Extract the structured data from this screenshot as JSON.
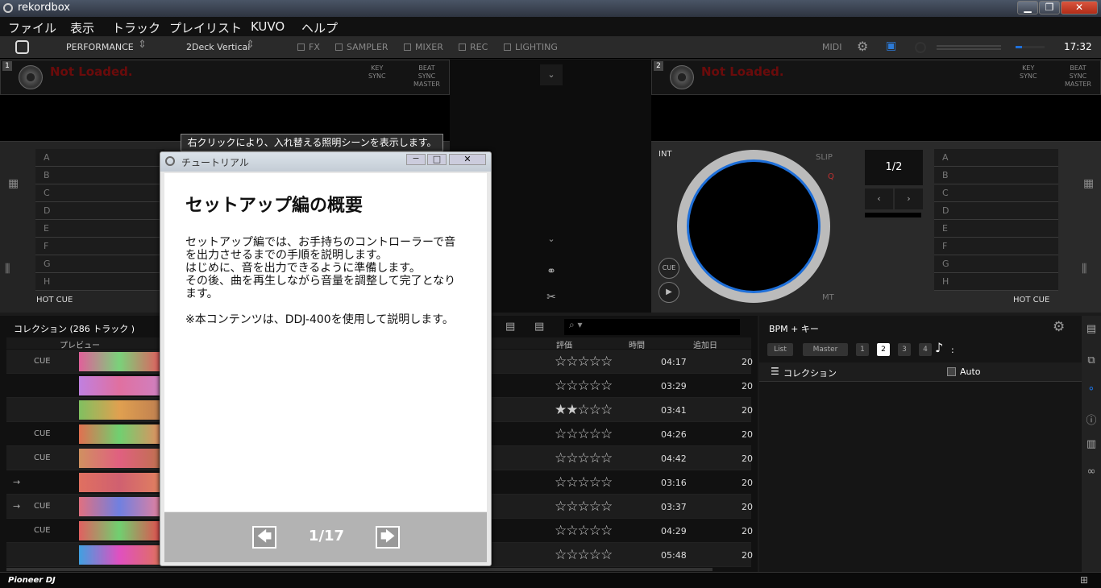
{
  "window": {
    "title": "rekordbox",
    "min": "▁",
    "max": "❐",
    "close": "✕"
  },
  "menu": [
    "ファイル",
    "表示",
    "トラック",
    "プレイリスト",
    "KUVO",
    "ヘルプ"
  ],
  "toolbar": {
    "mode": "PERFORMANCE",
    "layout": "2Deck Vertical",
    "toggles": [
      "FX",
      "SAMPLER",
      "MIXER",
      "REC",
      "LIGHTING"
    ],
    "midi": "MIDI",
    "clock": "17:32"
  },
  "deck1": {
    "number": "1",
    "status": "Not Loaded.",
    "key_sync": "KEY\nSYNC",
    "beat_sync": "BEAT\nSYNC\nMASTER",
    "hot_cue": "HOT CUE",
    "pads": [
      "A",
      "B",
      "C",
      "D",
      "E",
      "F",
      "G",
      "H"
    ]
  },
  "deck2": {
    "number": "2",
    "status": "Not Loaded.",
    "key_sync": "KEY\nSYNC",
    "beat_sync": "BEAT\nSYNC\nMASTER",
    "hot_cue": "HOT CUE",
    "pads": [
      "A",
      "B",
      "C",
      "D",
      "E",
      "F",
      "G",
      "H"
    ],
    "int": "INT",
    "slip": "SLIP",
    "q": "Q",
    "mt": "MT",
    "cue": "CUE",
    "loop": "1/2"
  },
  "tooltip": "右クリックにより、入れ替える照明シーンを表示します。",
  "dialog": {
    "title": "チュートリアル",
    "heading": "セットアップ編の概要",
    "body1": "セットアップ編では、お手持ちのコントローラーで音を出力させるまでの手順を説明します。",
    "body2": "はじめに、音を出力できるように準備します。",
    "body3": "その後、曲を再生しながら音量を調整して完了となります。",
    "note": "※本コンテンツは、DDJ-400を使用して説明します。",
    "page": "1/17",
    "prev": "🡄",
    "next": "🡆"
  },
  "browser": {
    "collection": "コレクション (286 トラック )",
    "col_preview": "プレビュー",
    "col_rating": "評価",
    "col_time": "時間",
    "col_added": "追加日",
    "rows": [
      {
        "cue": "CUE",
        "mark": "",
        "rating": "☆☆☆☆☆",
        "time": "04:17",
        "added": "20"
      },
      {
        "cue": "",
        "mark": "",
        "rating": "☆☆☆☆☆",
        "time": "03:29",
        "added": "20"
      },
      {
        "cue": "",
        "mark": "",
        "rating": "★★☆☆☆",
        "time": "03:41",
        "added": "20"
      },
      {
        "cue": "CUE",
        "mark": "",
        "rating": "☆☆☆☆☆",
        "time": "04:26",
        "added": "20"
      },
      {
        "cue": "CUE",
        "mark": "",
        "rating": "☆☆☆☆☆",
        "time": "04:42",
        "added": "20"
      },
      {
        "cue": "",
        "mark": "→",
        "rating": "☆☆☆☆☆",
        "time": "03:16",
        "added": "20"
      },
      {
        "cue": "CUE",
        "mark": "→",
        "rating": "☆☆☆☆☆",
        "time": "03:37",
        "added": "20"
      },
      {
        "cue": "CUE",
        "mark": "",
        "rating": "☆☆☆☆☆",
        "time": "04:29",
        "added": "20"
      },
      {
        "cue": "",
        "mark": "",
        "rating": "☆☆☆☆☆",
        "time": "05:48",
        "added": "20"
      }
    ]
  },
  "rpanel": {
    "title": "BPM + キー",
    "chips": [
      "List",
      "Master",
      "1",
      "2",
      "3",
      "4"
    ],
    "colon": ":",
    "collection": "コレクション",
    "auto": "Auto"
  },
  "brand": "Pioneer DJ",
  "colors": {
    "accent": "#1e6fd9",
    "notloaded": "#6a0b0b"
  }
}
